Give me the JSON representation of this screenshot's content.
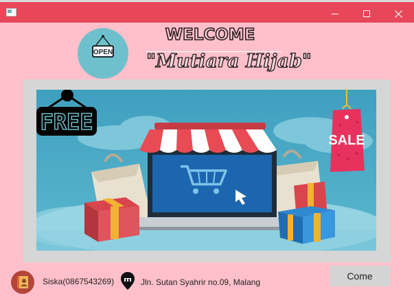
{
  "window": {
    "minimize_icon": "minimize-icon",
    "maximize_icon": "maximize-icon",
    "close_icon": "close-icon",
    "title_color": "#e8475a"
  },
  "header": {
    "open_sign": "OPEN",
    "welcome": "WELCOME",
    "shop_name": "\"Mutiara Hijab\""
  },
  "banner": {
    "free_label": "FREE",
    "sale_label": "SALE",
    "background_color": "#4aa3c2"
  },
  "footer": {
    "contact": "Siska(0867543269)",
    "address": "Jln. Sutan Syahrir no.09, Malang",
    "come_button": "Come"
  },
  "colors": {
    "page_background": "#ffc0cb",
    "accent_red": "#e8475a"
  }
}
